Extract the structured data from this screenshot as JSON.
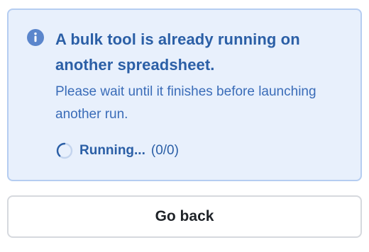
{
  "notice": {
    "icon": "info-icon",
    "title": "A bulk tool is already running on another spreadsheet.",
    "body": "Please wait until it finishes before launching another run.",
    "status": {
      "icon": "spinner-icon",
      "label": "Running...",
      "count": "(0/0)"
    },
    "colors": {
      "background": "#e8f0fc",
      "border": "#b5cdf1",
      "accent": "#2b5fa6",
      "icon": "#5b86cc"
    }
  },
  "actions": {
    "back_label": "Go back"
  }
}
